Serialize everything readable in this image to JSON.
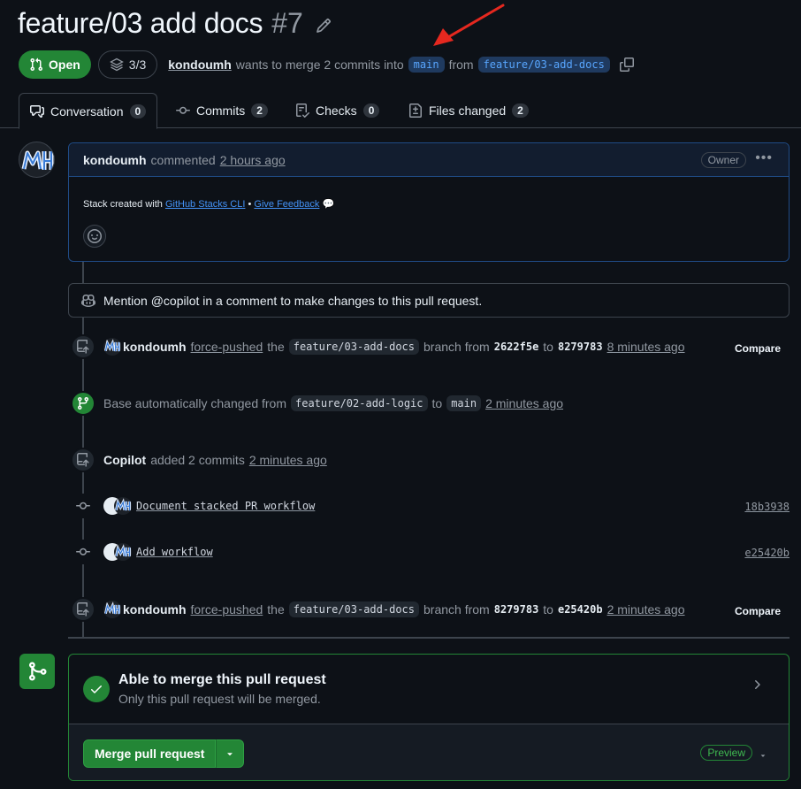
{
  "pr": {
    "title": "feature/03 add docs",
    "number": "#7",
    "state": "Open",
    "stack_progress": "3/3",
    "author": "kondoumh",
    "merge_text": "wants to merge 2 commits into",
    "base_branch": "main",
    "from_text": "from",
    "head_branch": "feature/03-add-docs"
  },
  "tabs": [
    {
      "label": "Conversation",
      "count": "0"
    },
    {
      "label": "Commits",
      "count": "2"
    },
    {
      "label": "Checks",
      "count": "0"
    },
    {
      "label": "Files changed",
      "count": "2"
    }
  ],
  "comment": {
    "author": "kondoumh",
    "action": "commented",
    "time": "2 hours ago",
    "role": "Owner",
    "body_prefix": "Stack created with",
    "body_link": "GitHub Stacks CLI",
    "body_sep": "•",
    "feedback_link": "Give Feedback",
    "feedback_emoji": "💬"
  },
  "copilot_banner": "Mention @copilot in a comment to make changes to this pull request.",
  "timeline": {
    "push1": {
      "user": "kondoumh",
      "action": "force-pushed",
      "the": "the",
      "branch": "feature/03-add-docs",
      "branch_word": "branch from",
      "from_sha": "2622f5e",
      "to": "to",
      "to_sha": "8279783",
      "time": "8 minutes ago",
      "compare": "Compare"
    },
    "base": {
      "text": "Base automatically changed from",
      "from": "feature/02-add-logic",
      "to_word": "to",
      "to": "main",
      "time": "2 minutes ago"
    },
    "added": {
      "user": "Copilot",
      "action": "added 2 commits",
      "time": "2 minutes ago"
    },
    "commits": [
      {
        "message": "Document stacked PR workflow",
        "sha": "18b3938"
      },
      {
        "message": "Add workflow",
        "sha": "e25420b"
      }
    ],
    "push2": {
      "user": "kondoumh",
      "action": "force-pushed",
      "the": "the",
      "branch": "feature/03-add-docs",
      "branch_word": "branch from",
      "from_sha": "8279783",
      "to": "to",
      "to_sha": "e25420b",
      "time": "2 minutes ago",
      "compare": "Compare"
    }
  },
  "merge": {
    "title": "Able to merge this pull request",
    "subtitle": "Only this pull request will be merged.",
    "button": "Merge pull request",
    "preview": "Preview"
  },
  "colors": {
    "open_green": "#238636",
    "link_blue": "#4493f8",
    "annotation_red": "#e5281f"
  }
}
